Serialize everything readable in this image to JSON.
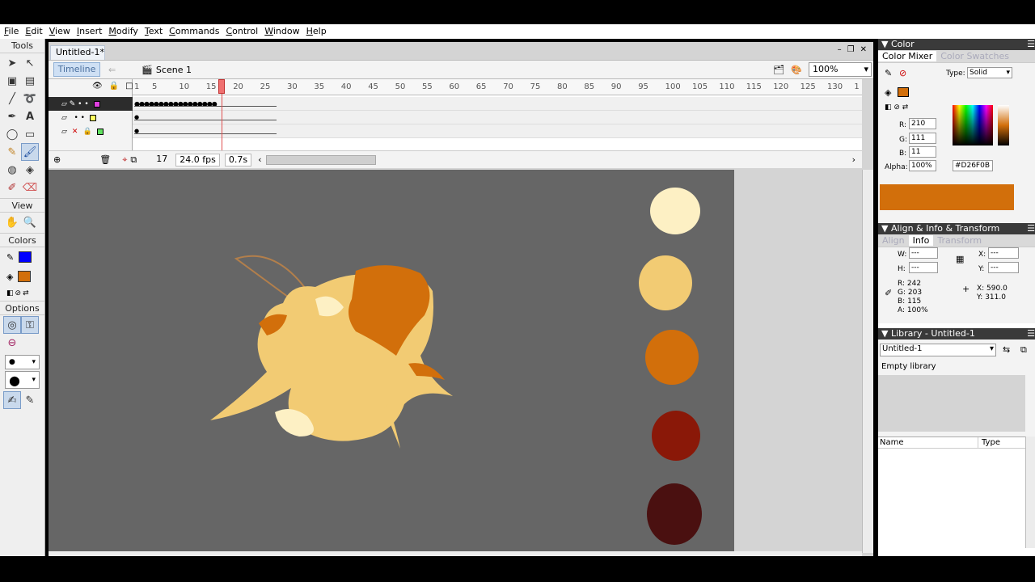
{
  "menu": [
    "File",
    "Edit",
    "View",
    "Insert",
    "Modify",
    "Text",
    "Commands",
    "Control",
    "Window",
    "Help"
  ],
  "tools_panel": {
    "title": "Tools",
    "view": "View",
    "colors": "Colors",
    "options": "Options"
  },
  "document": {
    "tab": "Untitled-1*",
    "timeline_button": "Timeline",
    "scene": "Scene 1",
    "zoom": "100%"
  },
  "timeline": {
    "ruler_labels": [
      "1",
      "5",
      "10",
      "15",
      "20",
      "25",
      "30",
      "35",
      "40",
      "45",
      "50",
      "55",
      "60",
      "65",
      "70",
      "75",
      "80",
      "85",
      "90",
      "95",
      "100",
      "105",
      "110",
      "115",
      "120",
      "125",
      "130",
      "1"
    ],
    "current_frame": "17",
    "fps": "24.0 fps",
    "elapsed": "0.7s"
  },
  "color_panel": {
    "header": "Color",
    "tab_mixer": "Color Mixer",
    "tab_swatches": "Color Swatches",
    "type_label": "Type:",
    "type_value": "Solid",
    "r_label": "R:",
    "r": "210",
    "g_label": "G:",
    "g": "111",
    "b_label": "B:",
    "b": "11",
    "alpha_label": "Alpha:",
    "alpha": "100%",
    "hex": "#D26F0B",
    "preview": "#D26F0B"
  },
  "info_panel": {
    "header": "Align & Info & Transform",
    "tab_align": "Align",
    "tab_info": "Info",
    "tab_transform": "Transform",
    "w_label": "W:",
    "w": "---",
    "h_label": "H:",
    "h": "---",
    "x_label": "X:",
    "x": "---",
    "y_label": "Y:",
    "y": "---",
    "r": "R: 242",
    "g": "G: 203",
    "b": "B: 115",
    "a": "A: 100%",
    "cx": "X: 590.0",
    "cy": "Y: 311.0"
  },
  "library_panel": {
    "header": "Library - Untitled-1",
    "dropdown": "Untitled-1",
    "empty": "Empty library",
    "col_name": "Name",
    "col_type": "Type"
  },
  "palette": [
    "#FDF0C4",
    "#F2CB73",
    "#D26F0B",
    "#8A1808",
    "#4A1010"
  ]
}
